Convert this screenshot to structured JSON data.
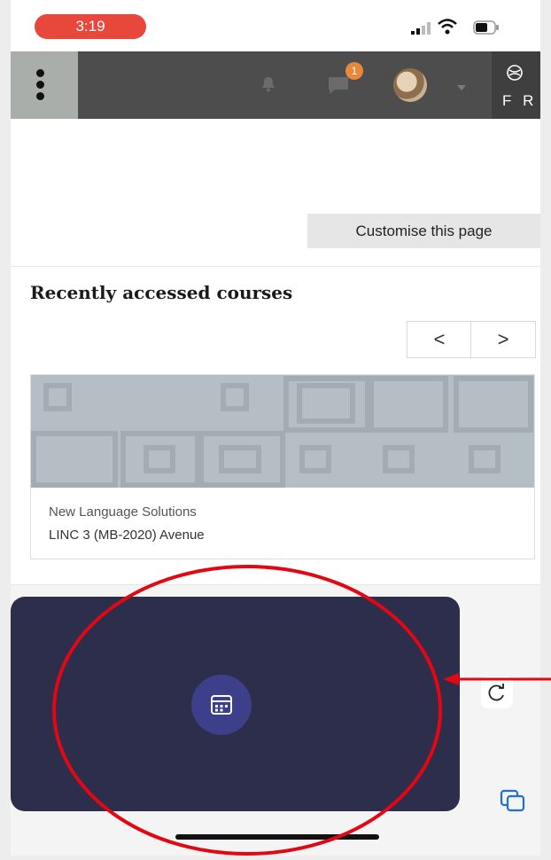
{
  "status_bar": {
    "time": "3:19"
  },
  "navbar": {
    "notifications_badge": "1",
    "language_label": "F R"
  },
  "page": {
    "customise_label": "Customise this page",
    "section_title": "Recently accessed courses",
    "pager": {
      "prev": "<",
      "next": ">"
    },
    "course": {
      "category": "New Language Solutions",
      "name": "LINC 3 (MB-2020) Avenue"
    }
  },
  "colors": {
    "status_pill": "#e8483b",
    "navbar": "#4d4d4d",
    "overlay": "#2d2d4c",
    "calendar_button": "#3e3f8a",
    "annotation": "#e30613",
    "badge": "#e8873a"
  },
  "icons": {
    "navbar": [
      "menu-icon",
      "bell-icon",
      "chat-icon",
      "avatar",
      "globe-icon"
    ],
    "overlay": [
      "calendar-icon"
    ],
    "browser": [
      "reload-icon",
      "tabs-icon"
    ]
  }
}
